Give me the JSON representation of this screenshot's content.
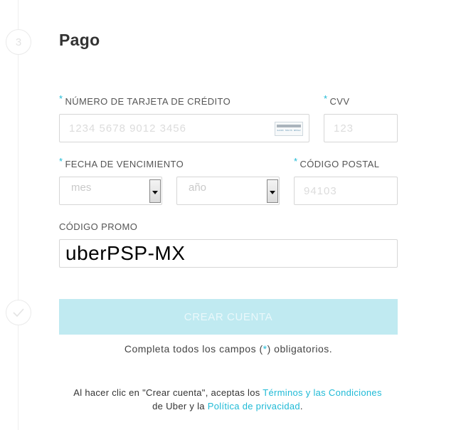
{
  "step": {
    "number": "3"
  },
  "section": {
    "title": "Pago"
  },
  "required_mark": "*",
  "card_number": {
    "label": "NÚMERO DE TARJETA DE CRÉDITO",
    "placeholder": "1234 5678 9012 3456",
    "icon": "credit-card-icon",
    "icon_text": "1234 5678 9012"
  },
  "cvv": {
    "label": "CVV",
    "placeholder": "123"
  },
  "expiry": {
    "label": "FECHA DE VENCIMIENTO",
    "month": "mes",
    "year": "año"
  },
  "postal_code": {
    "label": "CÓDIGO POSTAL",
    "placeholder": "94103"
  },
  "promo": {
    "label": "CÓDIGO PROMO",
    "value": "uberPSP-MX"
  },
  "submit": {
    "label": "CREAR CUENTA"
  },
  "note": {
    "before": "Completa todos los campos (",
    "asterisk": "*",
    "after": ") obligatorios."
  },
  "legal": {
    "prefix": "Al hacer clic en \"Crear cuenta\", aceptas los ",
    "terms_link": "Términos y las Condiciones",
    "middle": " de Uber y la ",
    "privacy_link": "Política de privacidad",
    "suffix": "."
  },
  "colors": {
    "accent": "#1fbad6",
    "button_disabled": "#c0eaf1"
  }
}
